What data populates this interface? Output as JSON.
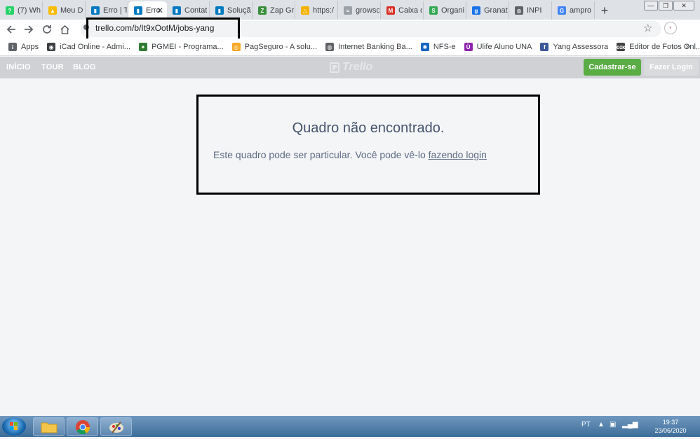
{
  "browser": {
    "tabs": [
      {
        "title": "(7) Wh",
        "color": "#25d366",
        "glyph": "?"
      },
      {
        "title": "Meu D",
        "color": "#fbbc04",
        "glyph": "▲"
      },
      {
        "title": "Erro | T",
        "color": "#0079bf",
        "glyph": "▮"
      },
      {
        "title": "Erro",
        "color": "#0079bf",
        "glyph": "▮",
        "active": true
      },
      {
        "title": "Contat",
        "color": "#0079bf",
        "glyph": "▮"
      },
      {
        "title": "Soluçã",
        "color": "#0079bf",
        "glyph": "▮"
      },
      {
        "title": "Zap Gr",
        "color": "#3a8f3a",
        "glyph": "Z"
      },
      {
        "title": "https:/",
        "color": "#f4b400",
        "glyph": "△"
      },
      {
        "title": "growsc",
        "color": "#9aa0a6",
        "glyph": "≈"
      },
      {
        "title": "Caixa d",
        "color": "#d93025",
        "glyph": "M"
      },
      {
        "title": "Organi",
        "color": "#34a853",
        "glyph": "S"
      },
      {
        "title": "Granat",
        "color": "#1a73e8",
        "glyph": "g"
      },
      {
        "title": "INPI",
        "color": "#5f6368",
        "glyph": "◍"
      },
      {
        "title": "ampro",
        "color": "#4285f4",
        "glyph": "G"
      }
    ],
    "close_tab_glyph": "✕",
    "new_tab_glyph": "+",
    "url": "trello.com/b/It9xOotM/jobs-yang",
    "bookmarks": [
      {
        "label": "Apps",
        "color": "#5f6368",
        "glyph": "⁝"
      },
      {
        "label": "iCad Online - Admi...",
        "color": "#3c4043",
        "glyph": "◉"
      },
      {
        "label": "PGMEI - Programa...",
        "color": "#2e7d32",
        "glyph": "✦"
      },
      {
        "label": "PagSeguro - A solu...",
        "color": "#f9a825",
        "glyph": "◎"
      },
      {
        "label": "Internet Banking Ba...",
        "color": "#5f6368",
        "glyph": "◍"
      },
      {
        "label": "NFS-e",
        "color": "#1565c0",
        "glyph": "✺"
      },
      {
        "label": "Ulife Aluno UNA",
        "color": "#8e24aa",
        "glyph": "Ü"
      },
      {
        "label": "Yang Assessora",
        "color": "#3b5998",
        "glyph": "f"
      },
      {
        "label": "Editor de Fotos Onl...",
        "color": "#444444",
        "glyph": "ᴏɪᴋ"
      }
    ],
    "bookmarks_more": "»"
  },
  "trello": {
    "nav": [
      "INÍCIO",
      "TOUR",
      "BLOG"
    ],
    "logo_text": "Trello",
    "signup_label": "Cadastrar-se",
    "login_label": "Fazer Login",
    "error_title": "Quadro não encontrado.",
    "error_text": "Este quadro pode ser particular. Você pode vê-lo ",
    "error_link": "fazendo login"
  },
  "taskbar": {
    "language": "PT",
    "time": "19:37",
    "date": "23/06/2020"
  }
}
